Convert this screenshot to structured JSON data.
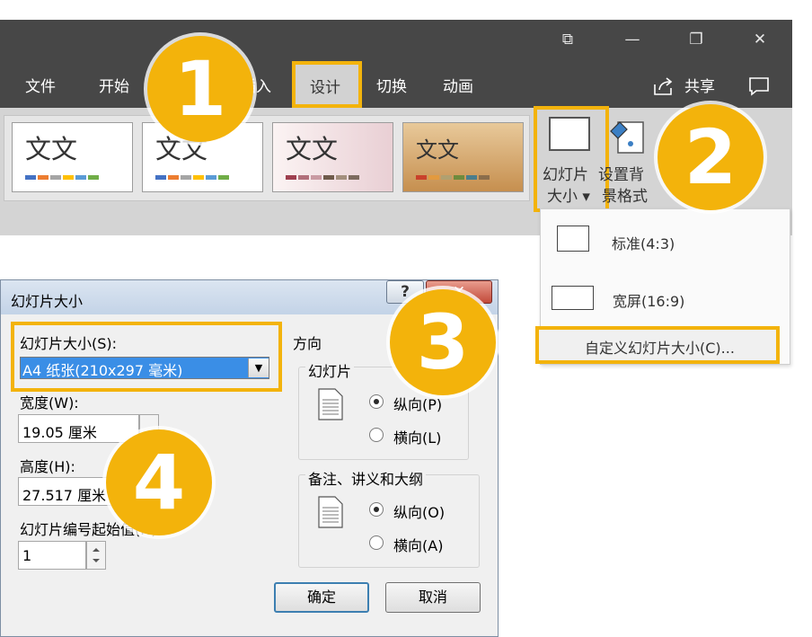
{
  "window": {
    "controls": [
      "⧉",
      "—",
      "❐",
      "✕"
    ],
    "tabs": [
      {
        "label": "文件"
      },
      {
        "label": "开始"
      },
      {
        "label": "插入"
      },
      {
        "label": "设计"
      },
      {
        "label": "切换"
      },
      {
        "label": "动画"
      }
    ],
    "share_label": "共享",
    "accent_color": "#f3b30b",
    "titlebar_color": "#474747"
  },
  "ribbon": {
    "themes": [
      {
        "text": "文文",
        "colors": [
          "#4472c4",
          "#ed7d31",
          "#a5a5a5",
          "#ffc000",
          "#5b9bd5",
          "#70ad47"
        ]
      },
      {
        "text": "文文",
        "colors": [
          "#4472c4",
          "#ed7d31",
          "#a5a5a5",
          "#ffc000",
          "#5b9bd5",
          "#70ad47"
        ]
      },
      {
        "text": "文文",
        "colors": [
          "#9e3f4f",
          "#b16f7a",
          "#c99aa2",
          "#6f5b4b",
          "#a38f7d",
          "#7d6b5e"
        ]
      },
      {
        "text": "文文",
        "colors": [
          "#c9412b",
          "#e29a3f",
          "#b0a070",
          "#6e8b3d",
          "#4a7d8c",
          "#8a6d4b"
        ]
      }
    ],
    "slide_size": {
      "line1": "幻灯片",
      "line2": "大小 ▾"
    },
    "bg_format": {
      "line1": "设置背",
      "line2": "景格式"
    }
  },
  "menu": {
    "standard": "标准(4:3)",
    "widescreen": "宽屏(16:9)",
    "custom": "自定义幻灯片大小(C)..."
  },
  "dialog": {
    "title": "幻灯片大小",
    "help": "?",
    "close": "✕",
    "size_label": "幻灯片大小(S):",
    "size_value": "A4 纸张(210x297 毫米)",
    "width_label": "宽度(W):",
    "width_value": "19.05 厘米",
    "height_label": "高度(H):",
    "height_value": "27.517 厘米",
    "start_label": "幻灯片编号起始值(N):",
    "start_value": "1",
    "orientation_label": "方向",
    "slides_group": "幻灯片",
    "portrait_label": "纵向(P)",
    "landscape_label": "横向(L)",
    "notes_group": "备注、讲义和大纲",
    "notes_portrait_label": "纵向(O)",
    "notes_landscape_label": "横向(A)",
    "ok": "确定",
    "cancel": "取消"
  },
  "callouts": [
    "1",
    "2",
    "3",
    "4"
  ]
}
